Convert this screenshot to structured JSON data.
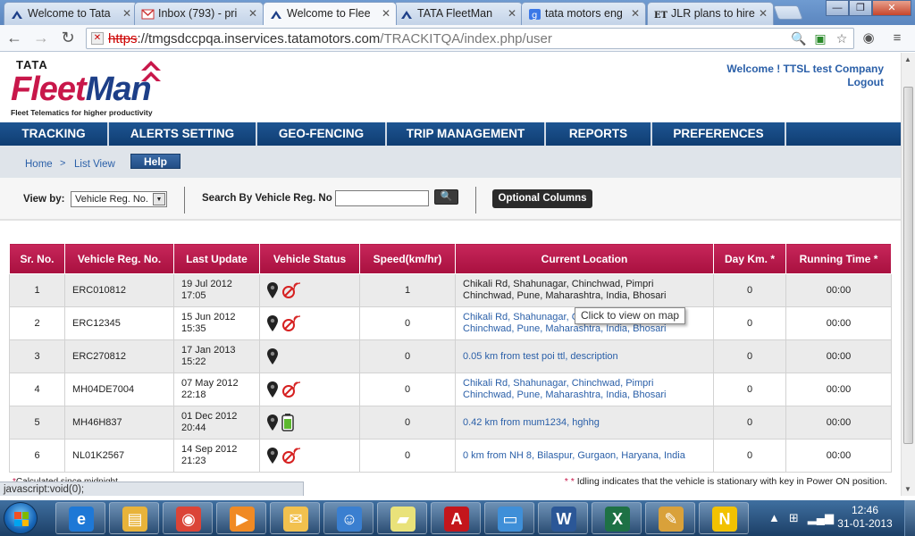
{
  "browser": {
    "tabs": [
      {
        "title": "Welcome to Tata",
        "icon": "tata-fleetman-icon"
      },
      {
        "title": "Inbox (793) - pri",
        "icon": "gmail-icon"
      },
      {
        "title": "Welcome to Flee",
        "icon": "tata-fleetman-icon"
      },
      {
        "title": "TATA FleetMan",
        "icon": "tata-fleetman-icon"
      },
      {
        "title": "tata motors eng",
        "icon": "google-icon"
      },
      {
        "title": "JLR plans to hire",
        "icon": "et-icon"
      }
    ],
    "url_scheme": "https",
    "url_host": "://tmgsdccpqa.inservices.tatamotors.com",
    "url_path": "/TRACKITQA/index.php/user"
  },
  "header": {
    "logo_top": "TATA",
    "logo_fleet": "Fleet",
    "logo_man": "Man",
    "tagline": "Fleet Telematics for higher productivity",
    "welcome": "Welcome ! TTSL test Company",
    "logout": "Logout"
  },
  "nav": {
    "items": [
      "TRACKING",
      "ALERTS SETTING",
      "GEO-FENCING",
      "TRIP MANAGEMENT",
      "REPORTS",
      "PREFERENCES"
    ]
  },
  "breadcrumb": {
    "home": "Home",
    "sep": ">",
    "list_view": "List View",
    "help": "Help"
  },
  "filters": {
    "view_by_label": "View by:",
    "view_by_value": "Vehicle Reg. No.",
    "search_label": "Search By Vehicle Reg. No :",
    "search_value": "",
    "optional_columns": "Optional Columns"
  },
  "table": {
    "headers": [
      "Sr. No.",
      "Vehicle Reg. No.",
      "Last Update",
      "Vehicle Status",
      "Speed(km/hr)",
      "Current Location",
      "Day Km. *",
      "Running Time *"
    ],
    "rows": [
      {
        "sr": "1",
        "reg": "ERC010812",
        "date": "19 Jul 2012",
        "time": "17:05",
        "status": [
          "pin",
          "no-signal"
        ],
        "speed": "1",
        "loc": "Chikali Rd, Shahunagar, Chinchwad, Pimpri Chinchwad, Pune, Maharashtra, India, Bhosari",
        "km": "0",
        "run": "00:00"
      },
      {
        "sr": "2",
        "reg": "ERC12345",
        "date": "15 Jun 2012",
        "time": "15:35",
        "status": [
          "pin",
          "no-signal"
        ],
        "speed": "0",
        "loc": "Chikali Rd, Shahunagar, Chinchwad, Pimpri Chinchwad, Pune, Maharashtra, India, Bhosari",
        "km": "0",
        "run": "00:00"
      },
      {
        "sr": "3",
        "reg": "ERC270812",
        "date": "17 Jan 2013",
        "time": "15:22",
        "status": [
          "pin"
        ],
        "speed": "0",
        "loc": "0.05 km from test poi ttl, description",
        "km": "0",
        "run": "00:00"
      },
      {
        "sr": "4",
        "reg": "MH04DE7004",
        "date": "07 May 2012",
        "time": "22:18",
        "status": [
          "pin",
          "no-signal"
        ],
        "speed": "0",
        "loc": "Chikali Rd, Shahunagar, Chinchwad, Pimpri Chinchwad, Pune, Maharashtra, India, Bhosari",
        "km": "0",
        "run": "00:00"
      },
      {
        "sr": "5",
        "reg": "MH46H837",
        "date": "01 Dec 2012",
        "time": "20:44",
        "status": [
          "pin",
          "battery"
        ],
        "speed": "0",
        "loc": "0.42 km from mum1234, hghhg",
        "km": "0",
        "run": "00:00"
      },
      {
        "sr": "6",
        "reg": "NL01K2567",
        "date": "14 Sep 2012",
        "time": "21:23",
        "status": [
          "pin",
          "no-signal"
        ],
        "speed": "0",
        "loc": "0 km from NH 8, Bilaspur, Gurgaon, Haryana, India",
        "km": "0",
        "run": "00:00"
      }
    ]
  },
  "tooltip": "Click to view on map",
  "footer": {
    "left_asterisk": "*",
    "left_text": "Calculated since midnight",
    "right_asterisk": "* *",
    "right_text": "Idling indicates that the vehicle is stationary with key in Power ON position."
  },
  "status_bar": "javascript:void(0);",
  "taskbar": {
    "apps": [
      "internet-explorer",
      "file-explorer",
      "chrome",
      "media-player",
      "outlook",
      "messenger",
      "sticky-notes",
      "acrobat",
      "remote-desktop",
      "word",
      "excel",
      "paint",
      "norton"
    ],
    "time": "12:46",
    "date": "31-01-2013"
  },
  "colors": {
    "brand_red": "#c8174a",
    "brand_blue": "#1d3f88",
    "nav_blue": "#1e5592",
    "link_blue": "#2a5fa8"
  }
}
